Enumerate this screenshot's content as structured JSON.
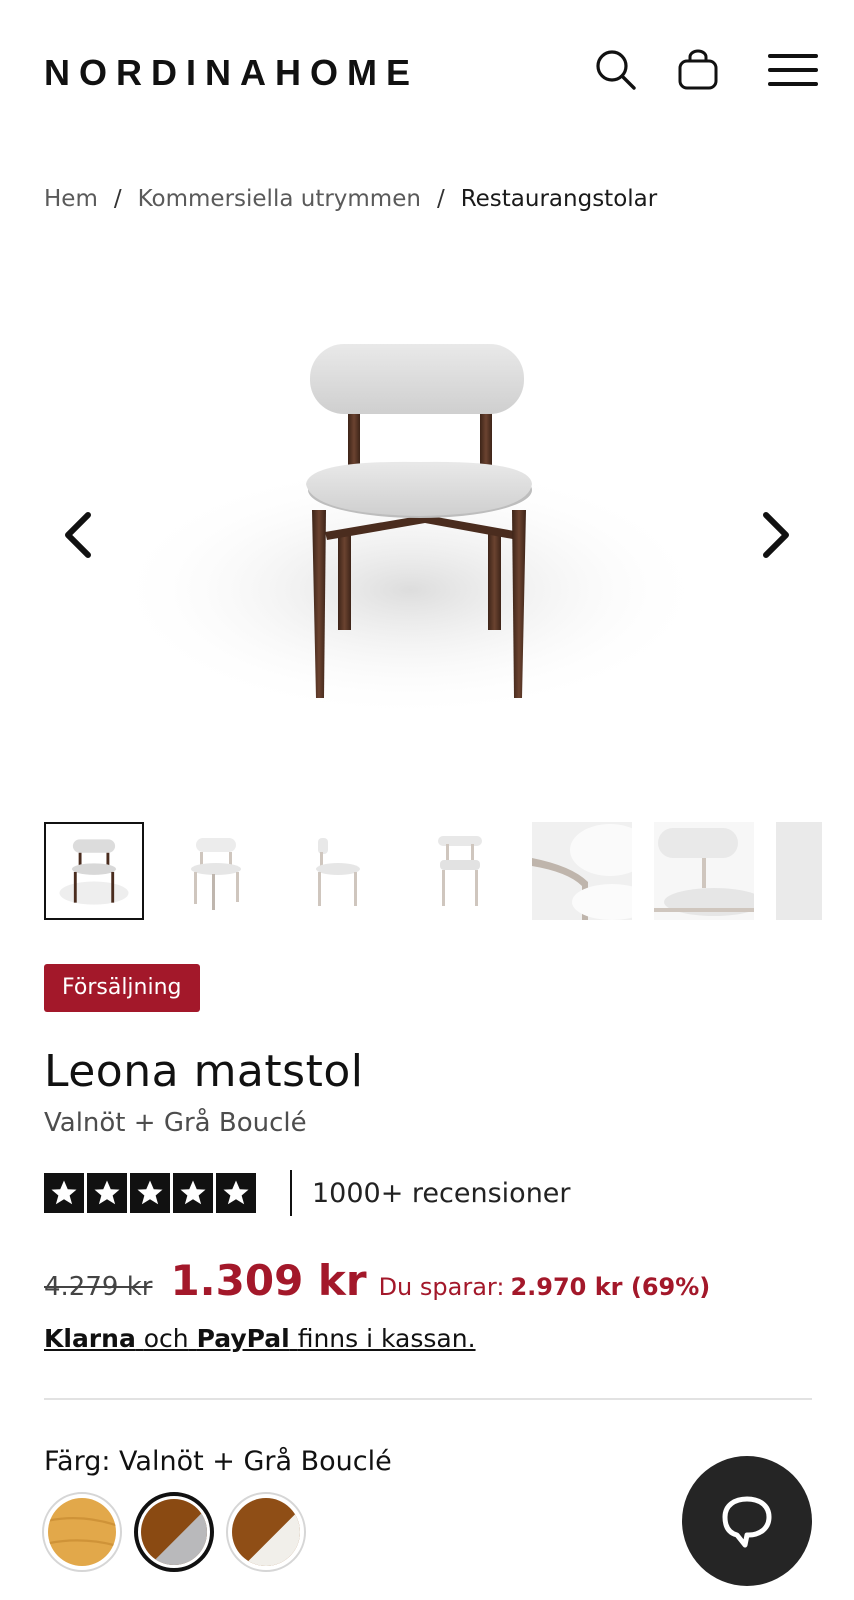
{
  "header": {
    "logo": "NORDINAHOME",
    "icons": [
      "search-icon",
      "bag-icon",
      "menu-icon"
    ]
  },
  "breadcrumb": {
    "items": [
      "Hem",
      "Kommersiella utrymmen",
      "Restaurangstolar"
    ],
    "separator": "/"
  },
  "gallery": {
    "thumbnail_count": 7,
    "active_index": 0,
    "icons": [
      "chevron-left-icon",
      "chevron-right-icon"
    ]
  },
  "product": {
    "badge": "Försäljning",
    "title": "Leona matstol",
    "variant": "Valnöt + Grå Bouclé",
    "rating": {
      "stars": 5,
      "max": 5,
      "reviews": "1000+ recensioner"
    },
    "price": {
      "old": "4.279 kr",
      "new": "1.309 kr",
      "save_label": "Du sparar:",
      "save_value": "2.970 kr (69%)"
    },
    "payment": {
      "klarna": "Klarna",
      "och": "och",
      "paypal": "PayPal",
      "suffix": "finns i kassan."
    },
    "color": {
      "label": "Färg: Valnöt + Grå Bouclé",
      "swatches": [
        {
          "name": "Ek",
          "colors": [
            "#e2a84a"
          ]
        },
        {
          "name": "Valnöt + Grå Bouclé",
          "colors": [
            "#8a4a12",
            "#b9b9bb"
          ],
          "selected": true
        },
        {
          "name": "Valnöt + Vit",
          "colors": [
            "#8f4e16",
            "#f1efea"
          ]
        }
      ]
    }
  },
  "colors": {
    "sale": "#a3182a",
    "text": "#111111",
    "chat": "#252525"
  }
}
